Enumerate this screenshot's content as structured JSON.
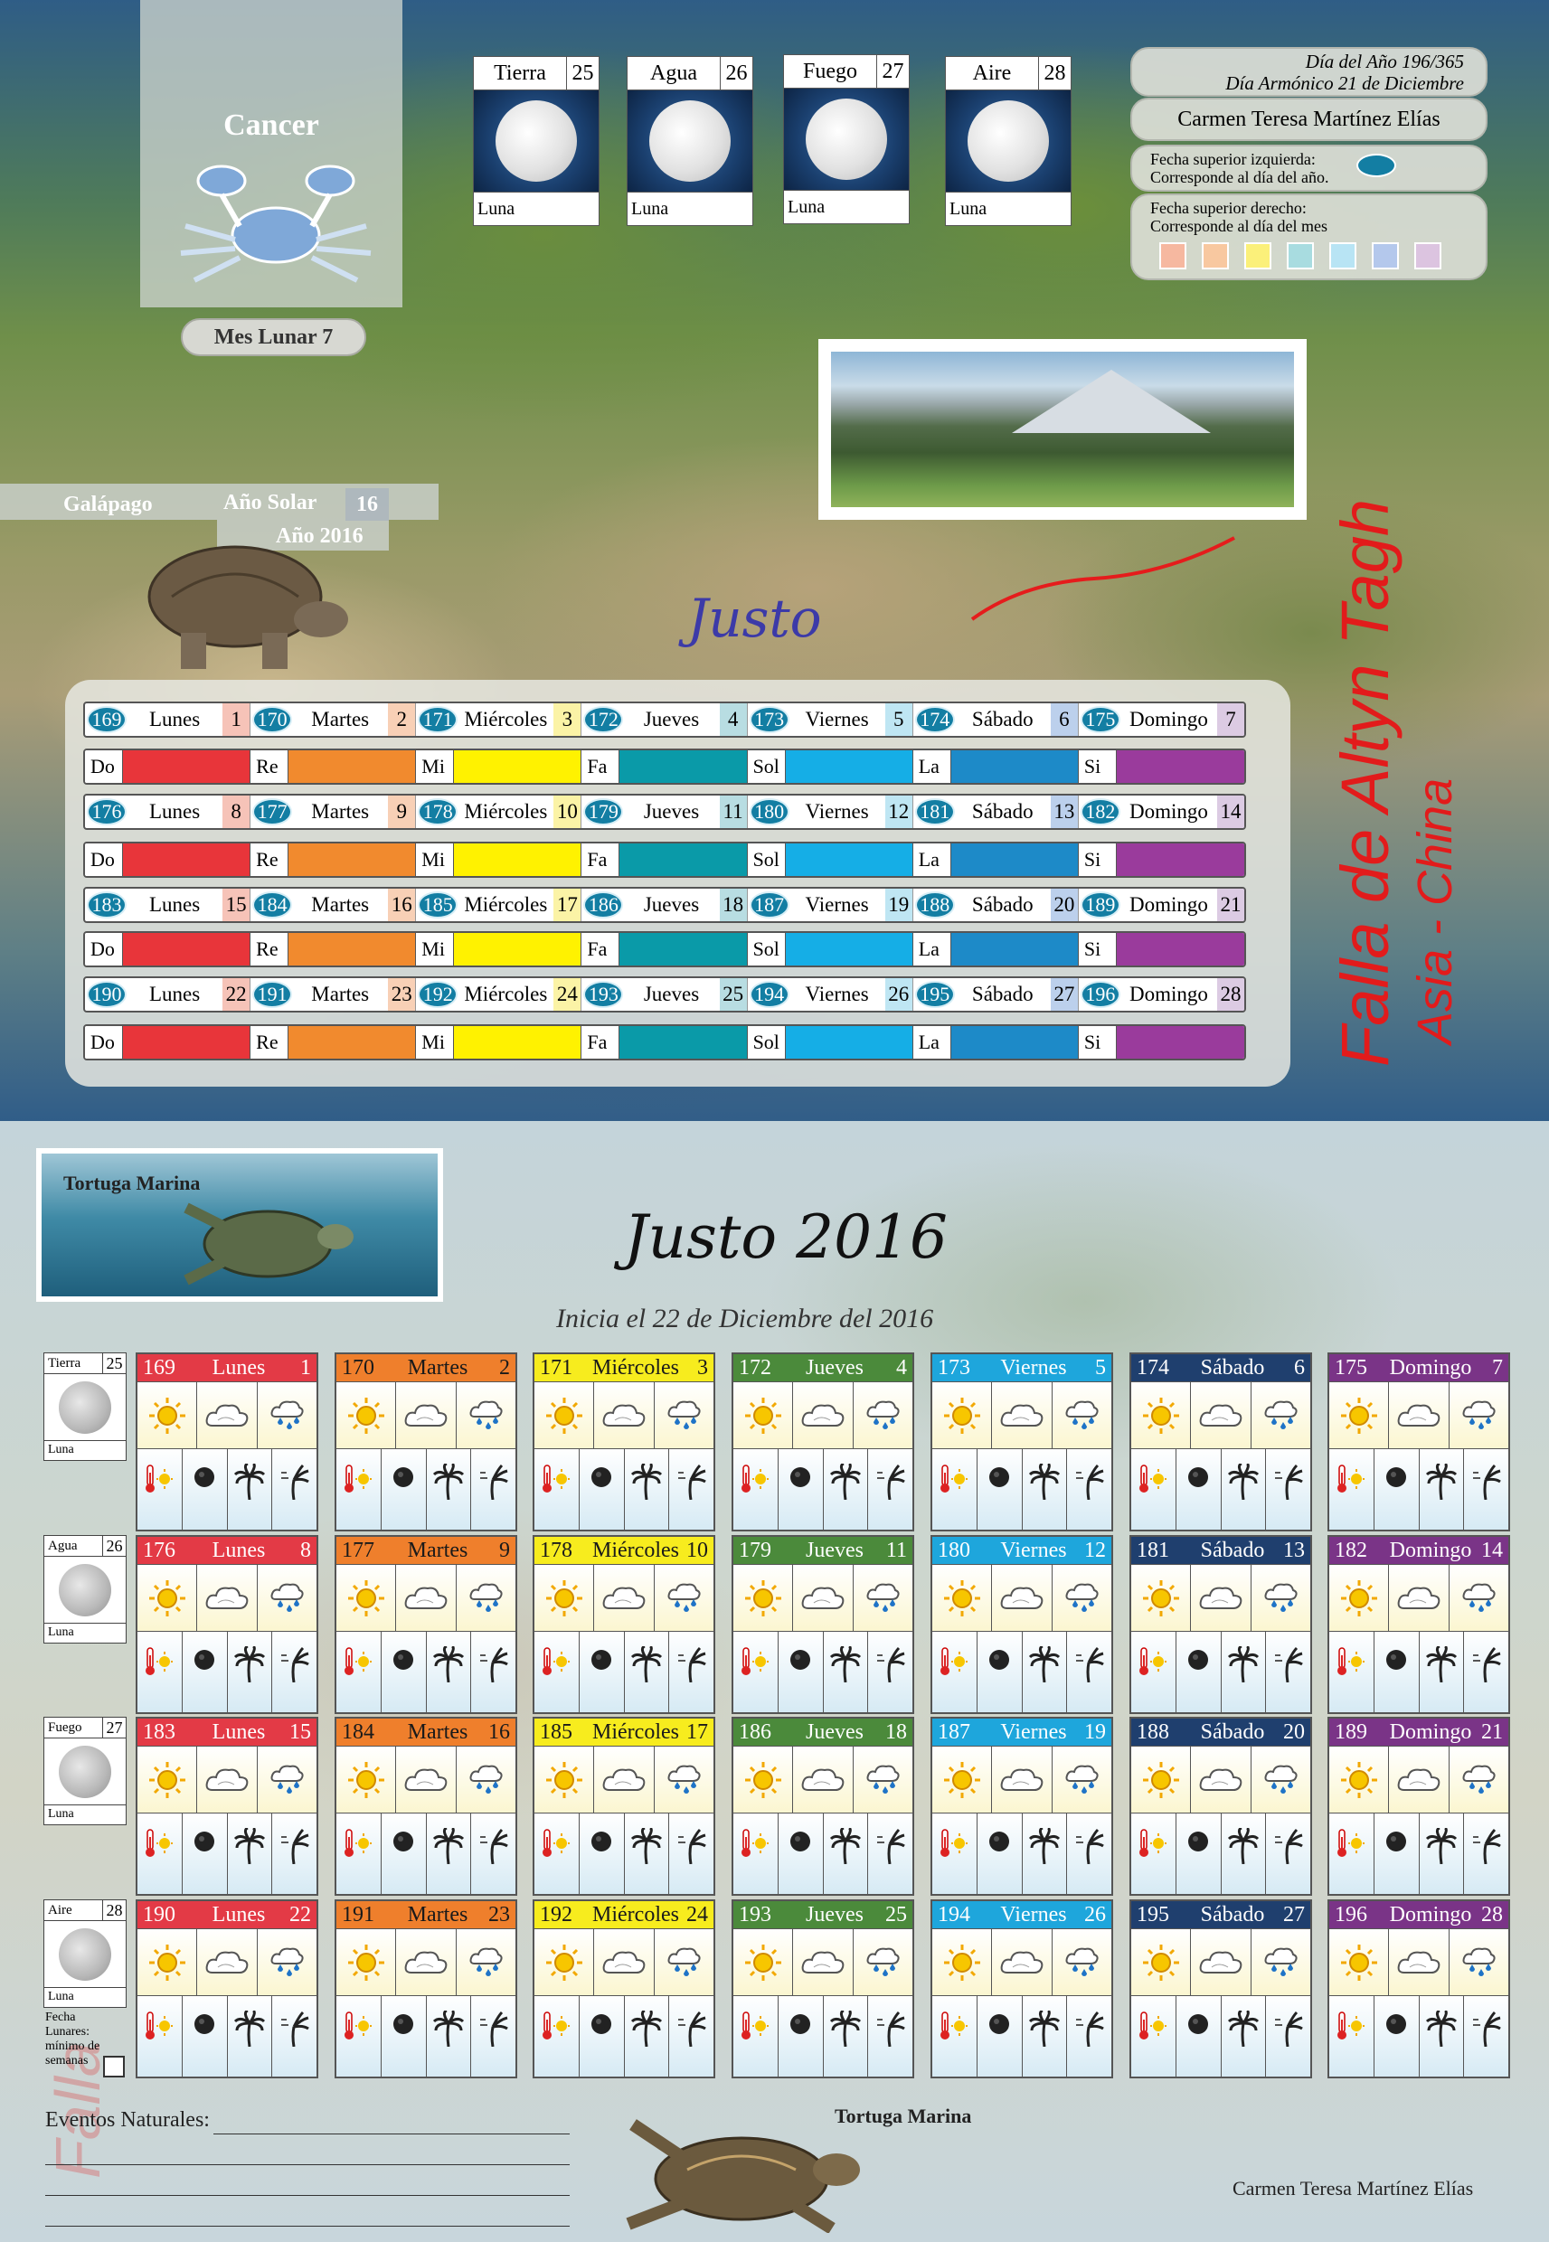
{
  "sign": {
    "name": "Cancer",
    "mes_lunar": "Mes Lunar 7"
  },
  "phases": [
    {
      "name": "Tierra",
      "num": "25",
      "foot": "Luna"
    },
    {
      "name": "Agua",
      "num": "26",
      "foot": "Luna"
    },
    {
      "name": "Fuego",
      "num": "27",
      "foot": "Luna"
    },
    {
      "name": "Aire",
      "num": "28",
      "foot": "Luna"
    }
  ],
  "info": {
    "line1": "Día del Año 196/365",
    "line2": "Día Armónico 21 de Diciembre",
    "author": "Carmen Teresa Martínez Elías",
    "left_note_1": "Fecha superior izquierda:",
    "left_note_2": "Corresponde al día del año.",
    "right_note_1": "Fecha superior derecho:",
    "right_note_2": "Corresponde al día del mes",
    "oval_color": "#137ea3",
    "swatches": [
      "#f6b8a0",
      "#f8c8a0",
      "#fbf07a",
      "#a8dce0",
      "#b8e4f4",
      "#b4c8ec",
      "#dcc4e0"
    ]
  },
  "galapago": {
    "name": "Galápago",
    "ano_solar": "Año Solar",
    "ano_solar_num": "16",
    "year": "Año 2016"
  },
  "justo_script": "Justo",
  "falla": {
    "line1": "Falla de Altyn Tagh",
    "line2": "Asia - China"
  },
  "notes": [
    "Do",
    "Re",
    "Mi",
    "Fa",
    "Sol",
    "La",
    "Si"
  ],
  "note_colors": [
    "#e8353a",
    "#f18a2e",
    "#fff200",
    "#0a9aa8",
    "#15aee6",
    "#1d8ac8",
    "#9a3b9c"
  ],
  "day_names": [
    "Lunes",
    "Martes",
    "Miércoles",
    "Jueves",
    "Viernes",
    "Sábado",
    "Domingo"
  ],
  "day_mon_tints": [
    "#f6c3b8",
    "#f8d0b6",
    "#fbf3a6",
    "#b8dde2",
    "#bfe6f3",
    "#bcd0ec",
    "#dccbe3"
  ],
  "weeks": [
    {
      "days": [
        "169",
        "170",
        "171",
        "172",
        "173",
        "174",
        "175"
      ],
      "mon": [
        "1",
        "2",
        "3",
        "4",
        "5",
        "6",
        "7"
      ]
    },
    {
      "days": [
        "176",
        "177",
        "178",
        "179",
        "180",
        "181",
        "182"
      ],
      "mon": [
        "8",
        "9",
        "10",
        "11",
        "12",
        "13",
        "14"
      ]
    },
    {
      "days": [
        "183",
        "184",
        "185",
        "186",
        "187",
        "188",
        "189"
      ],
      "mon": [
        "15",
        "16",
        "17",
        "18",
        "19",
        "20",
        "21"
      ]
    },
    {
      "days": [
        "190",
        "191",
        "192",
        "193",
        "194",
        "195",
        "196"
      ],
      "mon": [
        "22",
        "23",
        "24",
        "25",
        "26",
        "27",
        "28"
      ]
    }
  ],
  "bottom": {
    "turtle_label": "Tortuga Marina",
    "title": "Justo 2016",
    "subtitle": "Inicia el 22 de Diciembre del 2016",
    "head_colors": [
      "#e33a46",
      "#ef7f2c",
      "#f7ec1e",
      "#4b8a3b",
      "#1ea6dc",
      "#1f3f6e",
      "#7a3487"
    ],
    "head_text_colors": [
      "#ffffff",
      "#1a1a1a",
      "#1a1a1a",
      "#ffffff",
      "#ffffff",
      "#ffffff",
      "#ffffff"
    ],
    "fecha_note": "Fecha Lunares: mínimo de semanas",
    "eventos": "Eventos Naturales:",
    "turtle2_label": "Tortuga Marina",
    "author": "Carmen Teresa Martínez Elías"
  }
}
